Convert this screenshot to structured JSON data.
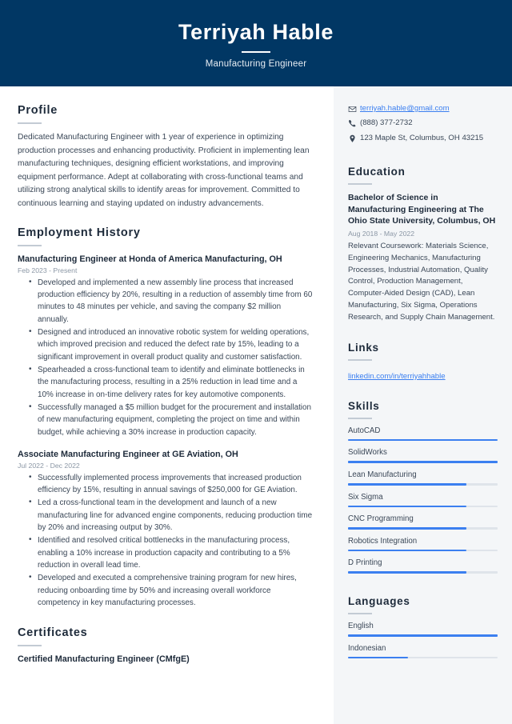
{
  "theme": {
    "header_bg": "#013764",
    "accent_blue": "#3b7ff0",
    "sidebar_bg": "#f4f6f8",
    "text_dark": "#1d2a3a",
    "text_body": "#3a4757",
    "muted": "#8b97a5"
  },
  "header": {
    "name": "Terriyah Hable",
    "role": "Manufacturing Engineer"
  },
  "profile": {
    "heading": "Profile",
    "text": "Dedicated Manufacturing Engineer with 1 year of experience in optimizing production processes and enhancing productivity. Proficient in implementing lean manufacturing techniques, designing efficient workstations, and improving equipment performance. Adept at collaborating with cross-functional teams and utilizing strong analytical skills to identify areas for improvement. Committed to continuous learning and staying updated on industry advancements."
  },
  "employment": {
    "heading": "Employment History",
    "jobs": [
      {
        "title": "Manufacturing Engineer at Honda of America Manufacturing, OH",
        "date": "Feb 2023 - Present",
        "bullets": [
          "Developed and implemented a new assembly line process that increased production efficiency by 20%, resulting in a reduction of assembly time from 60 minutes to 48 minutes per vehicle, and saving the company $2 million annually.",
          "Designed and introduced an innovative robotic system for welding operations, which improved precision and reduced the defect rate by 15%, leading to a significant improvement in overall product quality and customer satisfaction.",
          "Spearheaded a cross-functional team to identify and eliminate bottlenecks in the manufacturing process, resulting in a 25% reduction in lead time and a 10% increase in on-time delivery rates for key automotive components.",
          "Successfully managed a $5 million budget for the procurement and installation of new manufacturing equipment, completing the project on time and within budget, while achieving a 30% increase in production capacity."
        ]
      },
      {
        "title": "Associate Manufacturing Engineer at GE Aviation, OH",
        "date": "Jul 2022 - Dec 2022",
        "bullets": [
          "Successfully implemented process improvements that increased production efficiency by 15%, resulting in annual savings of $250,000 for GE Aviation.",
          "Led a cross-functional team in the development and launch of a new manufacturing line for advanced engine components, reducing production time by 20% and increasing output by 30%.",
          "Identified and resolved critical bottlenecks in the manufacturing process, enabling a 10% increase in production capacity and contributing to a 5% reduction in overall lead time.",
          "Developed and executed a comprehensive training program for new hires, reducing onboarding time by 50% and increasing overall workforce competency in key manufacturing processes."
        ]
      }
    ]
  },
  "certificates": {
    "heading": "Certificates",
    "items": [
      {
        "title": "Certified Manufacturing Engineer (CMfgE)"
      }
    ]
  },
  "contact": {
    "email": "terriyah.hable@gmail.com",
    "phone": "(888) 377-2732",
    "address": "123 Maple St, Columbus, OH 43215",
    "email_icon": "envelope-icon",
    "phone_icon": "phone-icon",
    "address_icon": "map-pin-icon"
  },
  "education": {
    "heading": "Education",
    "items": [
      {
        "title": "Bachelor of Science in Manufacturing Engineering at The Ohio State University, Columbus, OH",
        "date": "Aug 2018 - May 2022",
        "description": "Relevant Coursework: Materials Science, Engineering Mechanics, Manufacturing Processes, Industrial Automation, Quality Control, Production Management, Computer-Aided Design (CAD), Lean Manufacturing, Six Sigma, Operations Research, and Supply Chain Management."
      }
    ]
  },
  "links": {
    "heading": "Links",
    "items": [
      {
        "label": "linkedin.com/in/terriyahhable"
      }
    ]
  },
  "skills": {
    "heading": "Skills",
    "items": [
      {
        "label": "AutoCAD",
        "level": 100
      },
      {
        "label": "SolidWorks",
        "level": 100
      },
      {
        "label": "Lean Manufacturing",
        "level": 79
      },
      {
        "label": "Six Sigma",
        "level": 79
      },
      {
        "label": "CNC Programming",
        "level": 79
      },
      {
        "label": "Robotics Integration",
        "level": 79
      },
      {
        "label": "D Printing",
        "level": 79
      }
    ]
  },
  "languages": {
    "heading": "Languages",
    "items": [
      {
        "label": "English",
        "level": 100
      },
      {
        "label": "Indonesian",
        "level": 40
      }
    ]
  }
}
